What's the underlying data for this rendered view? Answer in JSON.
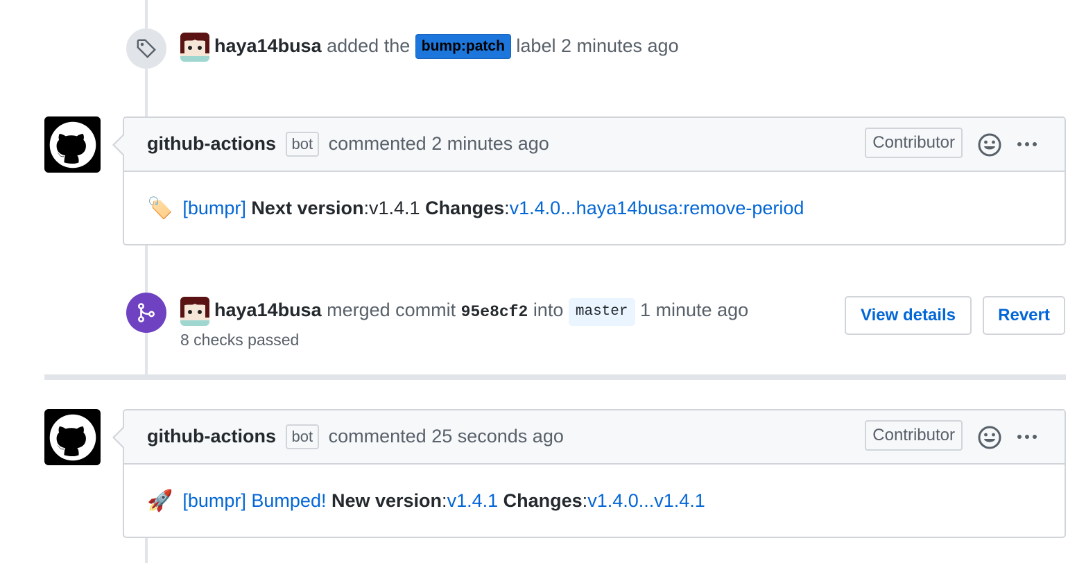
{
  "label_event": {
    "author": "haya14busa",
    "action": "added the",
    "label": "bump:patch",
    "suffix": "label",
    "time": "2 minutes ago"
  },
  "comment1": {
    "author": "github-actions",
    "bot_tag": "bot",
    "action": "commented",
    "time": "2 minutes ago",
    "role": "Contributor",
    "body": {
      "emoji": "🏷️",
      "link_prefix": "[bumpr]",
      "next_version_label": "Next version",
      "next_version_value": ":v1.4.1",
      "changes_label": "Changes",
      "colon": ":",
      "changes_link": "v1.4.0...haya14busa:remove-period"
    }
  },
  "merge_event": {
    "author": "haya14busa",
    "action": "merged commit",
    "sha": "95e8cf2",
    "into": "into",
    "branch": "master",
    "time": "1 minute ago",
    "checks": "8 checks passed",
    "view_details": "View details",
    "revert": "Revert"
  },
  "comment2": {
    "author": "github-actions",
    "bot_tag": "bot",
    "action": "commented",
    "time": "25 seconds ago",
    "role": "Contributor",
    "body": {
      "emoji": "🚀",
      "link_prefix": "[bumpr] Bumped!",
      "new_version_label": "New version",
      "colon": ":",
      "new_version_link": "v1.4.1",
      "changes_label": "Changes",
      "changes_link": "v1.4.0...v1.4.1"
    }
  },
  "colors": {
    "label_bg": "#1d76db",
    "merged_purple": "#6f42c1",
    "link": "#0366d6"
  }
}
